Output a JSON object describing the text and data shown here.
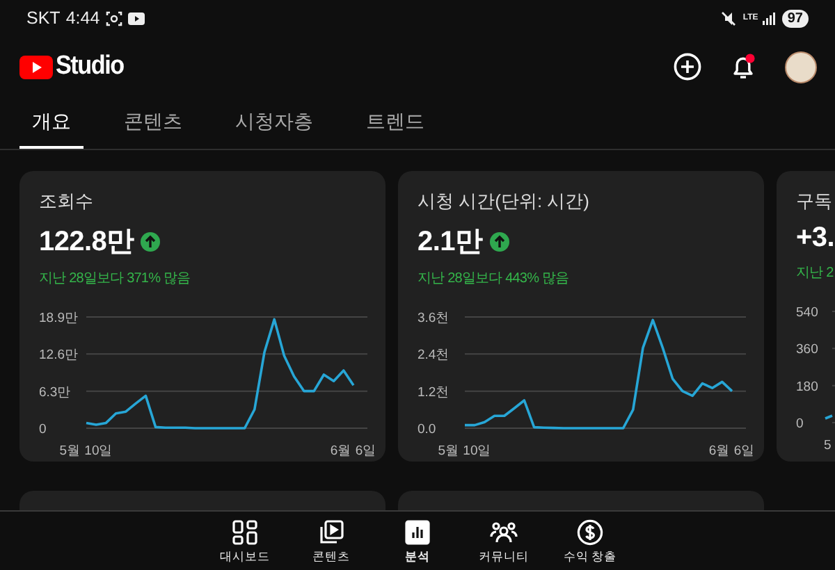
{
  "status_bar": {
    "carrier": "SKT",
    "time": "4:44",
    "network": "LTE",
    "battery": "97"
  },
  "header": {
    "logo_text": "Studio",
    "has_notification": true
  },
  "tabs": [
    {
      "label": "개요",
      "selected": true
    },
    {
      "label": "콘텐츠",
      "selected": false
    },
    {
      "label": "시청자층",
      "selected": false
    },
    {
      "label": "트렌드",
      "selected": false
    }
  ],
  "cards": [
    {
      "title": "조회수",
      "value": "122.8만",
      "increase": true,
      "change": "지난 28일보다 371% 많음",
      "chart_data": {
        "type": "line",
        "categories": [
          "5월 10일",
          null,
          null,
          null,
          null,
          null,
          null,
          null,
          null,
          null,
          null,
          null,
          null,
          null,
          null,
          null,
          null,
          null,
          null,
          null,
          null,
          null,
          null,
          null,
          null,
          null,
          null,
          "6월 6일"
        ],
        "series": [
          {
            "color": "#27a6d6",
            "values": [
              0.9,
              0.6,
              0.9,
              2.5,
              2.8,
              4.2,
              5.5,
              0.2,
              0.1,
              0.1,
              0.1,
              0,
              0,
              0,
              0,
              0,
              0,
              3.2,
              12.9,
              18.5,
              12.3,
              8.8,
              6.3,
              6.3,
              9.1,
              8.0,
              9.8,
              7.3
            ]
          }
        ],
        "ylim": [
          0,
          18.9
        ],
        "yticks": [
          {
            "value": 0,
            "label": "0"
          },
          {
            "value": 6.3,
            "label": "6.3만"
          },
          {
            "value": 12.6,
            "label": "12.6만"
          },
          {
            "value": 18.9,
            "label": "18.9만"
          }
        ]
      }
    },
    {
      "title": "시청 시간(단위: 시간)",
      "value": "2.1만",
      "increase": true,
      "change": "지난 28일보다 443% 많음",
      "chart_data": {
        "type": "line",
        "categories": [
          "5월 10일",
          null,
          null,
          null,
          null,
          null,
          null,
          null,
          null,
          null,
          null,
          null,
          null,
          null,
          null,
          null,
          null,
          null,
          null,
          null,
          null,
          null,
          null,
          null,
          null,
          null,
          null,
          "6월 6일"
        ],
        "series": [
          {
            "color": "#27a6d6",
            "values": [
              0.1,
              0.1,
              0.2,
              0.4,
              0.4,
              0.65,
              0.9,
              0.03,
              0.02,
              0.01,
              0,
              0,
              0,
              0,
              0,
              0,
              0,
              0.6,
              2.6,
              3.5,
              2.6,
              1.6,
              1.2,
              1.05,
              1.45,
              1.3,
              1.5,
              1.2
            ]
          }
        ],
        "ylim": [
          0,
          3.6
        ],
        "yticks": [
          {
            "value": 0,
            "label": "0.0"
          },
          {
            "value": 1.2,
            "label": "1.2천"
          },
          {
            "value": 2.4,
            "label": "2.4천"
          },
          {
            "value": 3.6,
            "label": "3.6천"
          }
        ]
      }
    },
    {
      "title": "구독",
      "value": "+3.",
      "change": "지난 2",
      "axis_labels": [
        "540",
        "360",
        "180",
        "0"
      ],
      "x_label": "5"
    }
  ],
  "bottom_nav": [
    {
      "label": "대시보드",
      "kind": "dashboard",
      "selected": false
    },
    {
      "label": "콘텐츠",
      "kind": "content",
      "selected": false
    },
    {
      "label": "분석",
      "kind": "analytics",
      "selected": true
    },
    {
      "label": "커뮤니티",
      "kind": "community",
      "selected": false
    },
    {
      "label": "수익 창출",
      "kind": "monetization",
      "selected": false
    }
  ]
}
